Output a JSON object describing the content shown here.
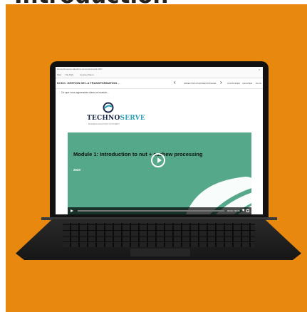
{
  "page_heading": "Introduction",
  "browser": {
    "url": "kiri-technoserve.talentlms.com/unit/view/id:2397",
    "bookmarks": [
      "Web",
      "My ASN",
      "Courses Menu"
    ]
  },
  "course": {
    "title": "DCKO: GESTION DE LA TRANSFORMATION ...",
    "prev_next_label": "OBJECTIFS D'APPRENTISSAGE",
    "nav_links": [
      "CONTINUER",
      "AJOUTER",
      "PLUS"
    ],
    "subtitle": "Ce que vous apprendrez dans ce module..."
  },
  "card": {
    "logo_text_main": "TECHNO",
    "logo_text_accent": "SERVE",
    "logo_tagline": "BUSINESS SOLUTIONS TO POVERTY"
  },
  "video": {
    "title": "Module 1: Introduction to nut + cashew processing",
    "year": "2020",
    "time": "00:00 / 05:36",
    "progress_fraction": 0.0
  },
  "colors": {
    "page_bg": "#e8880f",
    "video_bg": "#55a98a",
    "logo_text": "#1b2a4a",
    "logo_accent": "#2ba0b8"
  }
}
